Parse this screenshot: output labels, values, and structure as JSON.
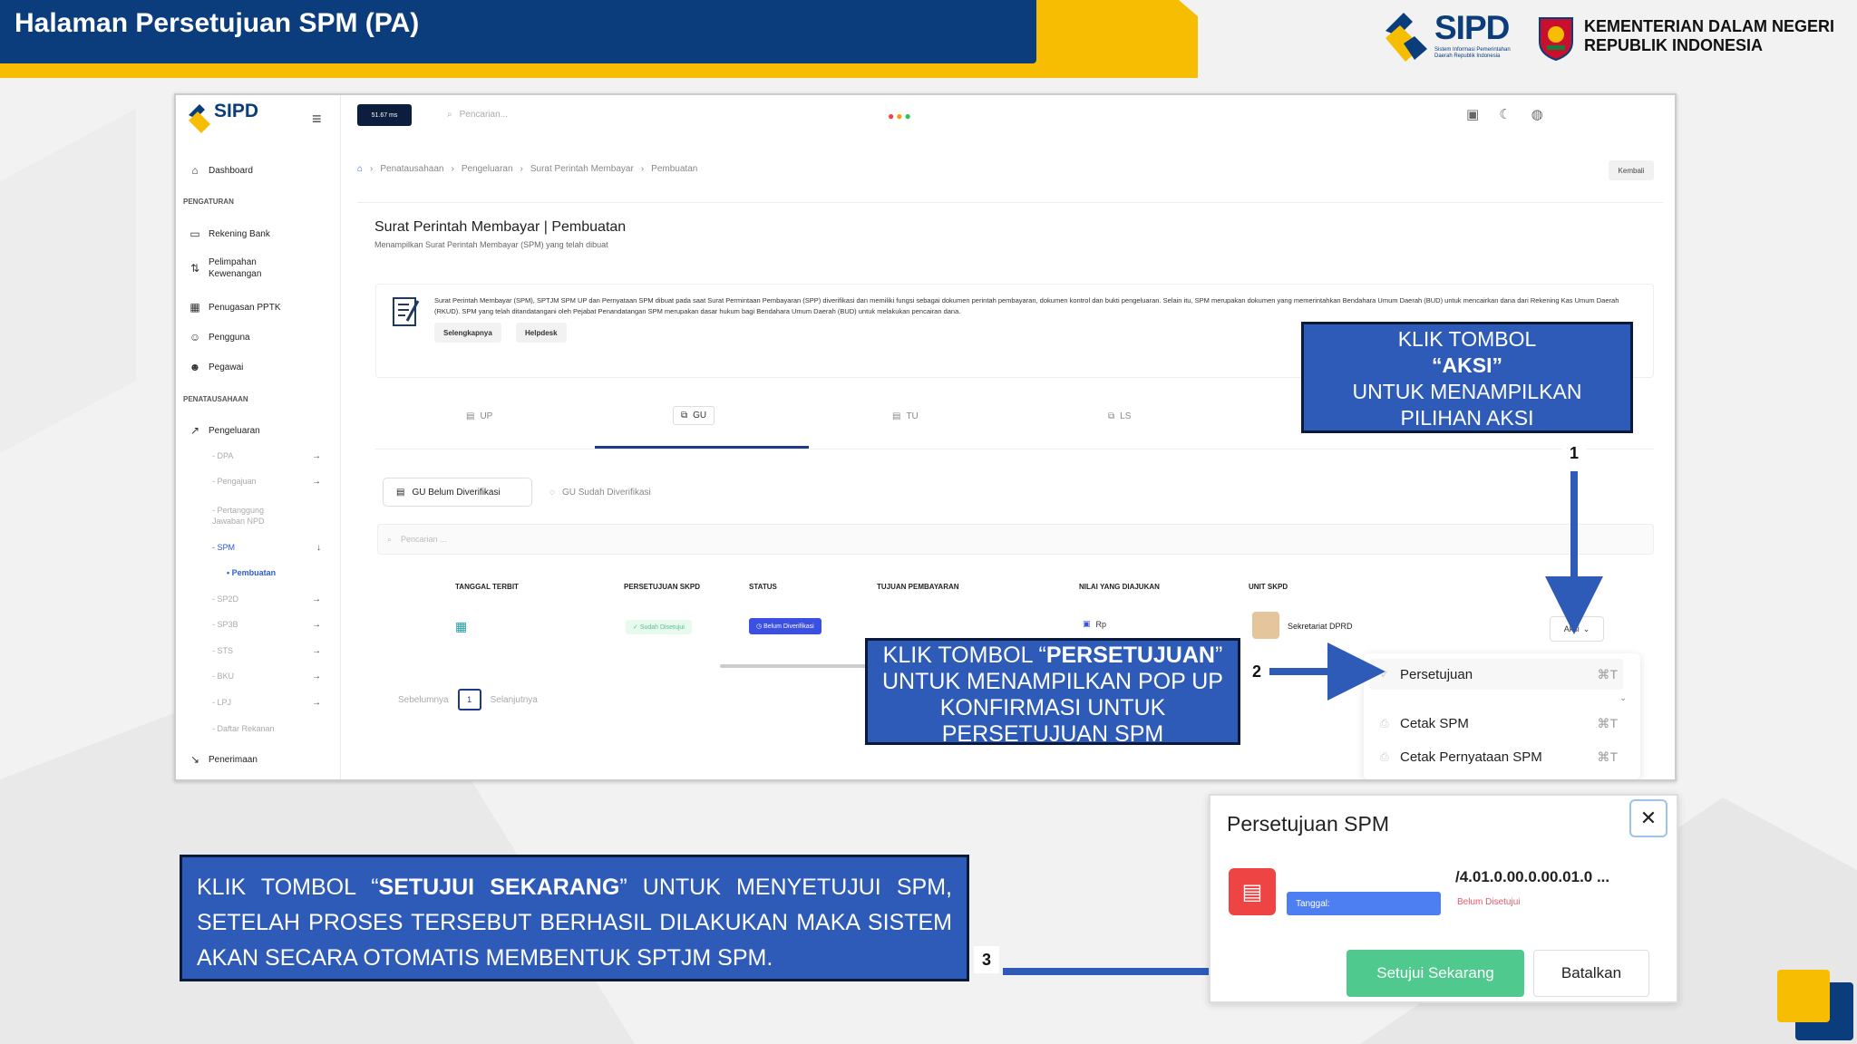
{
  "colors": {
    "navy": "#0b3d7c",
    "yellow": "#f7bd03",
    "callout_blue": "#2e5bb8",
    "approve_green": "#4fc98d"
  },
  "header": {
    "title": "Halaman Persetujuan SPM (PA)",
    "brand": "SIPD",
    "brand_sub": "Sistem Informasi Pemerintahan Daerah Republik Indonesia",
    "ministry_line1": "KEMENTERIAN DALAM NEGERI",
    "ministry_line2": "REPUBLIK INDONESIA"
  },
  "app": {
    "logo_text": "SIPD",
    "badge": "51.67 ms",
    "search_placeholder": "Pencarian...",
    "icons": [
      "layout-icon",
      "moon-icon",
      "globe-icon"
    ],
    "sidebar": {
      "dashboard": "Dashboard",
      "section_pengaturan": "PENGATURAN",
      "rekening": "Rekening Bank",
      "pelimpahan_1": "Pelimpahan",
      "pelimpahan_2": "Kewenangan",
      "penugasan": "Penugasan PPTK",
      "pengguna": "Pengguna",
      "pegawai": "Pegawai",
      "section_penatausahaan": "PENATAUSAHAAN",
      "pengeluaran": "Pengeluaran",
      "subs": [
        "DPA",
        "Pengajuan",
        "Pertanggung Jawaban NPD",
        "SPM",
        "SP2D",
        "SP3B",
        "STS",
        "BKU",
        "LPJ",
        "Daftar Rekanan"
      ],
      "pembuatan": "Pembuatan",
      "penerimaan": "Penerimaan"
    },
    "breadcrumb": [
      "Penatausahaan",
      "Pengeluaran",
      "Surat Perintah Membayar",
      "Pembuatan"
    ],
    "kembali": "Kembali",
    "page_title": "Surat Perintah Membayar | Pembuatan",
    "page_sub": "Menampilkan Surat Perintah Membayar (SPM) yang telah dibuat",
    "info_text": "Surat Perintah Membayar (SPM), SPTJM SPM UP dan Pernyataan SPM dibuat pada saat Surat Permintaan Pembayaran (SPP) diverifikasi dan memiliki fungsi sebagai dokumen perintah pembayaran, dokumen kontrol dan bukti pengeluaran. Selain itu, SPM merupakan dokumen yang memerintahkan Bendahara Umum Daerah (BUD) untuk mencairkan dana dari Rekening Kas Umum Daerah (RKUD). SPM yang telah ditandatangani oleh Pejabat Penandatangan SPM merupakan dasar hukum bagi Bendahara Umum Daerah (BUD) untuk melakukan pencairan dana.",
    "info_btn1": "Selengkapnya",
    "info_btn2": "Helpdesk",
    "tabs": [
      "UP",
      "GU",
      "TU",
      "LS"
    ],
    "subtab1": "GU Belum Diverifikasi",
    "subtab2": "GU Sudah Diverifikasi",
    "table_search": "Pencarian ...",
    "columns": [
      "TANGGAL TERBIT",
      "PERSETUJUAN SKPD",
      "STATUS",
      "TUJUAN PEMBAYARAN",
      "NILAI YANG DIAJUKAN",
      "UNIT SKPD"
    ],
    "row": {
      "persetujuan": "Sudah Disetujui",
      "status": "Belum Diverifikasi",
      "nilai": "Rp",
      "unit": "Sekretariat DPRD"
    },
    "aksi": "Aksi",
    "pager": {
      "prev": "Sebelumnya",
      "page": "1",
      "next": "Selanjutnya"
    },
    "dropdown": [
      {
        "label": "Persetujuan",
        "shortcut": "⌘T"
      },
      {
        "label": "Cetak SPM",
        "shortcut": "⌘T"
      },
      {
        "label": "Cetak Pernyataan SPM",
        "shortcut": "⌘T"
      }
    ]
  },
  "callouts": {
    "c1_line1": "KLIK TOMBOL",
    "c1_line2": "“AKSI”",
    "c1_line3": "UNTUK MENAMPILKAN",
    "c1_line4": "PILIHAN AKSI",
    "c2_pre": "KLIK TOMBOL “",
    "c2_bold": "PERSETUJUAN",
    "c2_post": "” UNTUK MENAMPILKAN POP UP KONFIRMASI UNTUK PERSETUJUAN SPM",
    "c3_pre": "KLIK TOMBOL “",
    "c3_bold": "SETUJUI SEKARANG",
    "c3_post": "” UNTUK MENYETUJUI SPM, SETELAH PROSES TERSEBUT BERHASIL DILAKUKAN MAKA SISTEM AKAN SECARA OTOMATIS MEMBENTUK SPTJM SPM.",
    "n1": "1",
    "n2": "2",
    "n3": "3"
  },
  "modal": {
    "title": "Persetujuan SPM",
    "code": "/4.01.0.00.0.00.01.0 ...",
    "date_label": "Tanggal:",
    "status": "Belum Disetujui",
    "ok": "Setujui Sekarang",
    "cancel": "Batalkan"
  }
}
